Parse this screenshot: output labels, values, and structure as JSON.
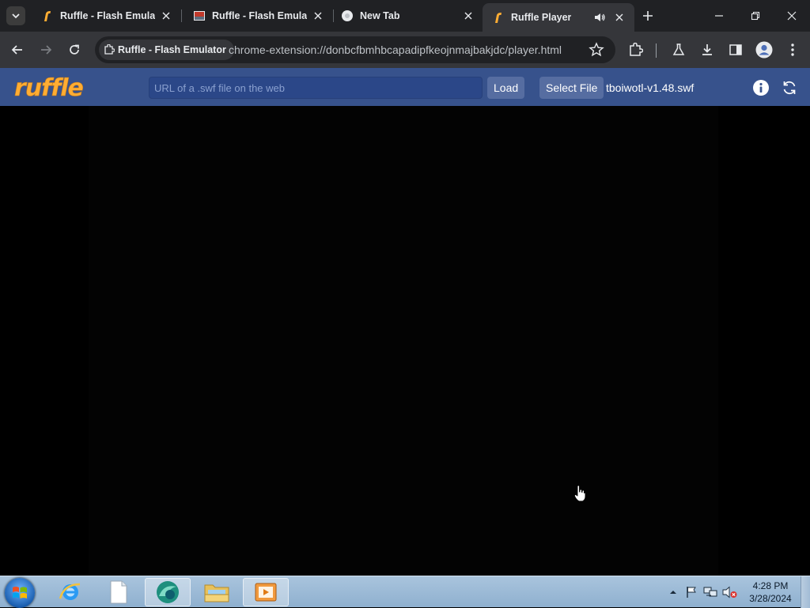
{
  "browser": {
    "tabs": [
      {
        "title": "Ruffle - Flash Emulator",
        "favicon": "ruffle-favicon"
      },
      {
        "title": "Ruffle - Flash Emulator",
        "favicon": "image-favicon"
      },
      {
        "title": "New Tab",
        "favicon": "chrome-favicon"
      },
      {
        "title": "Ruffle Player",
        "favicon": "ruffle-favicon",
        "audio": true,
        "active": true
      }
    ],
    "omnibox": {
      "site_chip": "Ruffle - Flash Emulator",
      "url": "chrome-extension://donbcfbmhbcapadipfkeojnmajbakjdc/player.html"
    }
  },
  "ruffle": {
    "logo_text": "ruffle",
    "url_placeholder": "URL of a .swf file on the web",
    "url_value": "",
    "load_label": "Load",
    "select_file_label": "Select File",
    "file_name": "tboiwotl-v1.48.swf"
  },
  "taskbar": {
    "apps": [
      "internet-explorer",
      "blank-document",
      "browser-app",
      "file-explorer",
      "media-player"
    ],
    "clock_time": "4:28 PM",
    "clock_date": "3/28/2024"
  },
  "colors": {
    "ruffle_header": "#37528c",
    "ruffle_accent": "#ffad33",
    "chrome_dark": "#202124"
  }
}
